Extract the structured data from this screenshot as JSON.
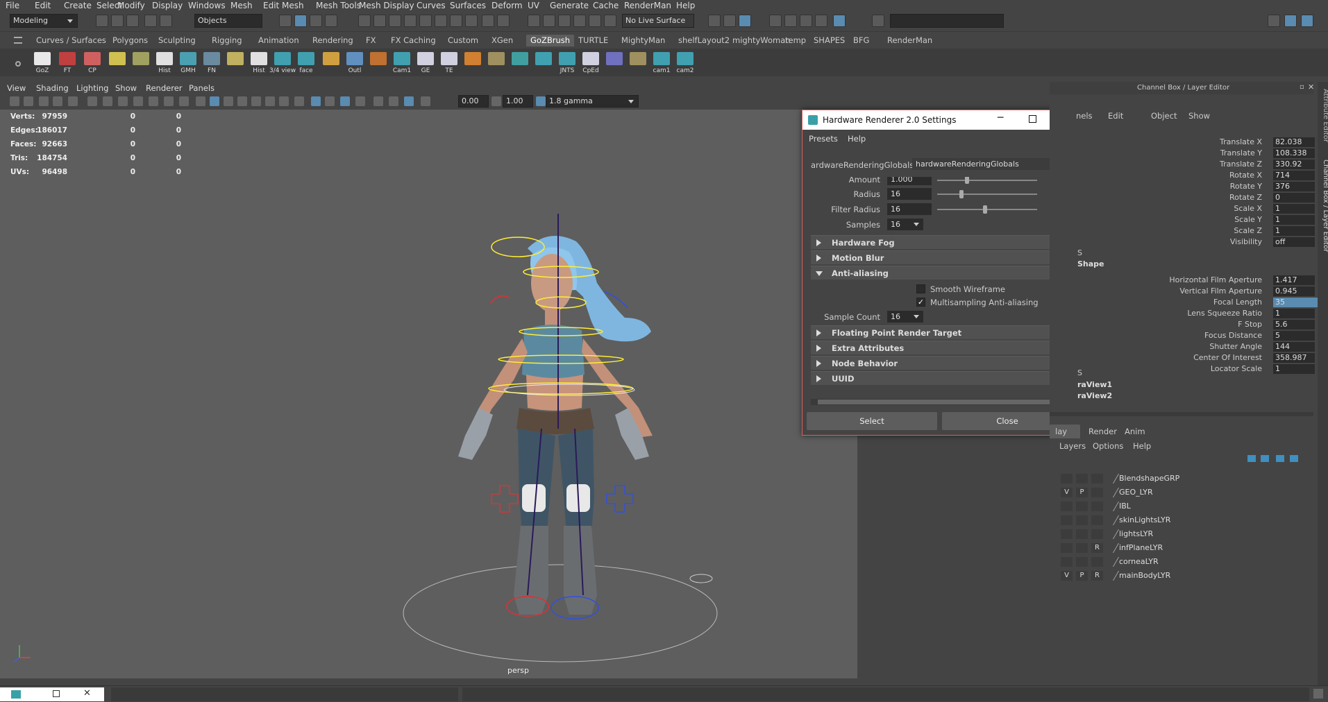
{
  "menubar": [
    "File",
    "Edit",
    "Create",
    "Select",
    "Modify",
    "Display",
    "Windows",
    "Mesh",
    "Edit Mesh",
    "Mesh Tools",
    "Mesh Display",
    "Curves",
    "Surfaces",
    "Deform",
    "UV",
    "Generate",
    "Cache",
    "RenderMan",
    "Help"
  ],
  "status": {
    "mode": "Modeling",
    "selection_mode": "Objects",
    "live_surface": "No Live Surface"
  },
  "shelf_tabs": [
    "Curves / Surfaces",
    "Polygons",
    "Sculpting",
    "Rigging",
    "Animation",
    "Rendering",
    "FX",
    "FX Caching",
    "Custom",
    "XGen",
    "GoZBrush",
    "TURTLE",
    "MightyMan",
    "shelfLayout2",
    "mightyWoman",
    "temp",
    "SHAPES",
    "BFG",
    "RenderMan"
  ],
  "shelf_selected": "GoZBrush",
  "shelf_icons": [
    "GoZ",
    "FT",
    "CP",
    "",
    "",
    "Hist",
    "GMH",
    "FN",
    "",
    "Hist",
    "3/4 view",
    "face",
    "",
    "Outl",
    "",
    "Cam1",
    "GE",
    "TE",
    "",
    "",
    "",
    "",
    "JNTS",
    "CpEd",
    "",
    "",
    "cam1",
    "cam2"
  ],
  "viewport_menu": [
    "View",
    "Shading",
    "Lighting",
    "Show",
    "Renderer",
    "Panels"
  ],
  "viewport_toolbar": {
    "exposure": "0.00",
    "gamma": "1.00",
    "colorspace": "1.8 gamma"
  },
  "hud": [
    {
      "label": "Verts:",
      "v1": "97959",
      "v2": "0",
      "v3": "0"
    },
    {
      "label": "Edges:",
      "v1": "186017",
      "v2": "0",
      "v3": "0"
    },
    {
      "label": "Faces:",
      "v1": "92663",
      "v2": "0",
      "v3": "0"
    },
    {
      "label": "Tris:",
      "v1": "184754",
      "v2": "0",
      "v3": "0"
    },
    {
      "label": "UVs:",
      "v1": "96498",
      "v2": "0",
      "v3": "0"
    }
  ],
  "camera_label": "persp",
  "dialog": {
    "title": "Hardware Renderer 2.0 Settings",
    "menu": [
      "Presets",
      "Help"
    ],
    "node_label": "ardwareRenderingGlobals:",
    "node_value": "hardwareRenderingGlobals",
    "amount_label": "Amount",
    "amount_value": "1.000",
    "radius_label": "Radius",
    "radius_value": "16",
    "filter_radius_label": "Filter Radius",
    "filter_radius_value": "16",
    "samples_label": "Samples",
    "samples_value": "16",
    "sections": [
      "Hardware Fog",
      "Motion Blur",
      "Anti-aliasing",
      "Floating Point Render Target",
      "Extra Attributes",
      "Node Behavior",
      "UUID"
    ],
    "smooth_wireframe": "Smooth Wireframe",
    "multisampling": "Multisampling Anti-aliasing",
    "sample_count_label": "Sample Count",
    "sample_count_value": "16",
    "select_button": "Select",
    "close_button": "Close"
  },
  "channel_box": {
    "title": "Channel Box / Layer Editor",
    "menu": [
      "nels",
      "Edit",
      "Object",
      "Show"
    ],
    "transforms": [
      {
        "name": "Translate X",
        "value": "82.038"
      },
      {
        "name": "Translate Y",
        "value": "108.338"
      },
      {
        "name": "Translate Z",
        "value": "330.92"
      },
      {
        "name": "Rotate X",
        "value": "714"
      },
      {
        "name": "Rotate Y",
        "value": "376"
      },
      {
        "name": "Rotate Z",
        "value": "0"
      },
      {
        "name": "Scale X",
        "value": "1"
      },
      {
        "name": "Scale Y",
        "value": "1"
      },
      {
        "name": "Scale Z",
        "value": "1"
      },
      {
        "name": "Visibility",
        "value": "off"
      }
    ],
    "shapes_header": "S",
    "shape_name": "Shape",
    "shape_attrs": [
      {
        "name": "Horizontal Film Aperture",
        "value": "1.417"
      },
      {
        "name": "Vertical Film Aperture",
        "value": "0.945"
      },
      {
        "name": "Focal Length",
        "value": "35"
      },
      {
        "name": "Lens Squeeze Ratio",
        "value": "1"
      },
      {
        "name": "F Stop",
        "value": "5.6"
      },
      {
        "name": "Focus Distance",
        "value": "5"
      },
      {
        "name": "Shutter Angle",
        "value": "144"
      },
      {
        "name": "Center Of Interest",
        "value": "358.987"
      },
      {
        "name": "Locator Scale",
        "value": "1"
      }
    ],
    "outputs_header": "S",
    "outputs": [
      "raView1",
      "raView2"
    ],
    "layer_tabs": [
      "lay",
      "Render",
      "Anim"
    ],
    "layer_menu": [
      "Layers",
      "Options",
      "Help"
    ],
    "layers": [
      {
        "v": "",
        "p": "",
        "r": "",
        "name": "BlendshapeGRP"
      },
      {
        "v": "V",
        "p": "P",
        "r": "",
        "name": "GEO_LYR"
      },
      {
        "v": "",
        "p": "",
        "r": "",
        "name": "IBL"
      },
      {
        "v": "",
        "p": "",
        "r": "",
        "name": "skinLightsLYR"
      },
      {
        "v": "",
        "p": "",
        "r": "",
        "name": "lightsLYR"
      },
      {
        "v": "",
        "p": "",
        "r": "R",
        "name": "infPlaneLYR"
      },
      {
        "v": "",
        "p": "",
        "r": "",
        "name": "corneaLYR"
      },
      {
        "v": "V",
        "p": "P",
        "r": "R",
        "name": "mainBodyLYR"
      }
    ],
    "side_tabs": [
      "Attribute Editor",
      "Channel Box / Layer Editor"
    ]
  },
  "colors": {
    "accent": "#5a8bb0",
    "dialog_border": "#e06060",
    "selected_field": "#5a8bb0"
  }
}
